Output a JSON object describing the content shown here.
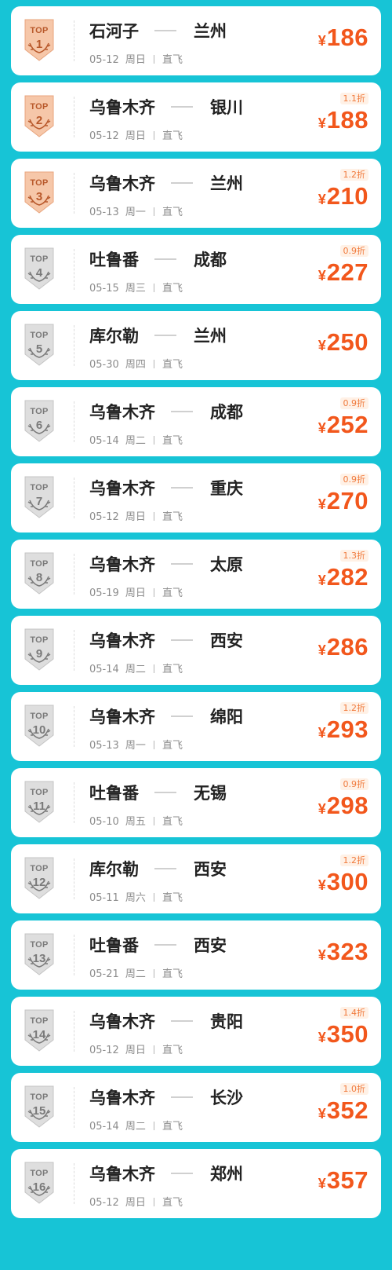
{
  "badge_word": "TOP",
  "colors": {
    "background": "#17c4d6",
    "price": "#f2571c",
    "bronze_badge": "#f5c4a8",
    "grey_badge": "#dcdcdc"
  },
  "rankings": [
    {
      "rank": "1",
      "tier": "bronze",
      "from": "石河子",
      "to": "兰州",
      "date": "05-12",
      "weekday": "周日",
      "type": "直飞",
      "currency": "¥",
      "price": "186",
      "discount": ""
    },
    {
      "rank": "2",
      "tier": "bronze",
      "from": "乌鲁木齐",
      "to": "银川",
      "date": "05-12",
      "weekday": "周日",
      "type": "直飞",
      "currency": "¥",
      "price": "188",
      "discount": "1.1折"
    },
    {
      "rank": "3",
      "tier": "bronze",
      "from": "乌鲁木齐",
      "to": "兰州",
      "date": "05-13",
      "weekday": "周一",
      "type": "直飞",
      "currency": "¥",
      "price": "210",
      "discount": "1.2折"
    },
    {
      "rank": "4",
      "tier": "grey",
      "from": "吐鲁番",
      "to": "成都",
      "date": "05-15",
      "weekday": "周三",
      "type": "直飞",
      "currency": "¥",
      "price": "227",
      "discount": "0.9折"
    },
    {
      "rank": "5",
      "tier": "grey",
      "from": "库尔勒",
      "to": "兰州",
      "date": "05-30",
      "weekday": "周四",
      "type": "直飞",
      "currency": "¥",
      "price": "250",
      "discount": ""
    },
    {
      "rank": "6",
      "tier": "grey",
      "from": "乌鲁木齐",
      "to": "成都",
      "date": "05-14",
      "weekday": "周二",
      "type": "直飞",
      "currency": "¥",
      "price": "252",
      "discount": "0.9折"
    },
    {
      "rank": "7",
      "tier": "grey",
      "from": "乌鲁木齐",
      "to": "重庆",
      "date": "05-12",
      "weekday": "周日",
      "type": "直飞",
      "currency": "¥",
      "price": "270",
      "discount": "0.9折"
    },
    {
      "rank": "8",
      "tier": "grey",
      "from": "乌鲁木齐",
      "to": "太原",
      "date": "05-19",
      "weekday": "周日",
      "type": "直飞",
      "currency": "¥",
      "price": "282",
      "discount": "1.3折"
    },
    {
      "rank": "9",
      "tier": "grey",
      "from": "乌鲁木齐",
      "to": "西安",
      "date": "05-14",
      "weekday": "周二",
      "type": "直飞",
      "currency": "¥",
      "price": "286",
      "discount": ""
    },
    {
      "rank": "10",
      "tier": "grey",
      "from": "乌鲁木齐",
      "to": "绵阳",
      "date": "05-13",
      "weekday": "周一",
      "type": "直飞",
      "currency": "¥",
      "price": "293",
      "discount": "1.2折"
    },
    {
      "rank": "11",
      "tier": "grey",
      "from": "吐鲁番",
      "to": "无锡",
      "date": "05-10",
      "weekday": "周五",
      "type": "直飞",
      "currency": "¥",
      "price": "298",
      "discount": "0.9折"
    },
    {
      "rank": "12",
      "tier": "grey",
      "from": "库尔勒",
      "to": "西安",
      "date": "05-11",
      "weekday": "周六",
      "type": "直飞",
      "currency": "¥",
      "price": "300",
      "discount": "1.2折"
    },
    {
      "rank": "13",
      "tier": "grey",
      "from": "吐鲁番",
      "to": "西安",
      "date": "05-21",
      "weekday": "周二",
      "type": "直飞",
      "currency": "¥",
      "price": "323",
      "discount": ""
    },
    {
      "rank": "14",
      "tier": "grey",
      "from": "乌鲁木齐",
      "to": "贵阳",
      "date": "05-12",
      "weekday": "周日",
      "type": "直飞",
      "currency": "¥",
      "price": "350",
      "discount": "1.4折"
    },
    {
      "rank": "15",
      "tier": "grey",
      "from": "乌鲁木齐",
      "to": "长沙",
      "date": "05-14",
      "weekday": "周二",
      "type": "直飞",
      "currency": "¥",
      "price": "352",
      "discount": "1.0折"
    },
    {
      "rank": "16",
      "tier": "grey",
      "from": "乌鲁木齐",
      "to": "郑州",
      "date": "05-12",
      "weekday": "周日",
      "type": "直飞",
      "currency": "¥",
      "price": "357",
      "discount": ""
    }
  ]
}
